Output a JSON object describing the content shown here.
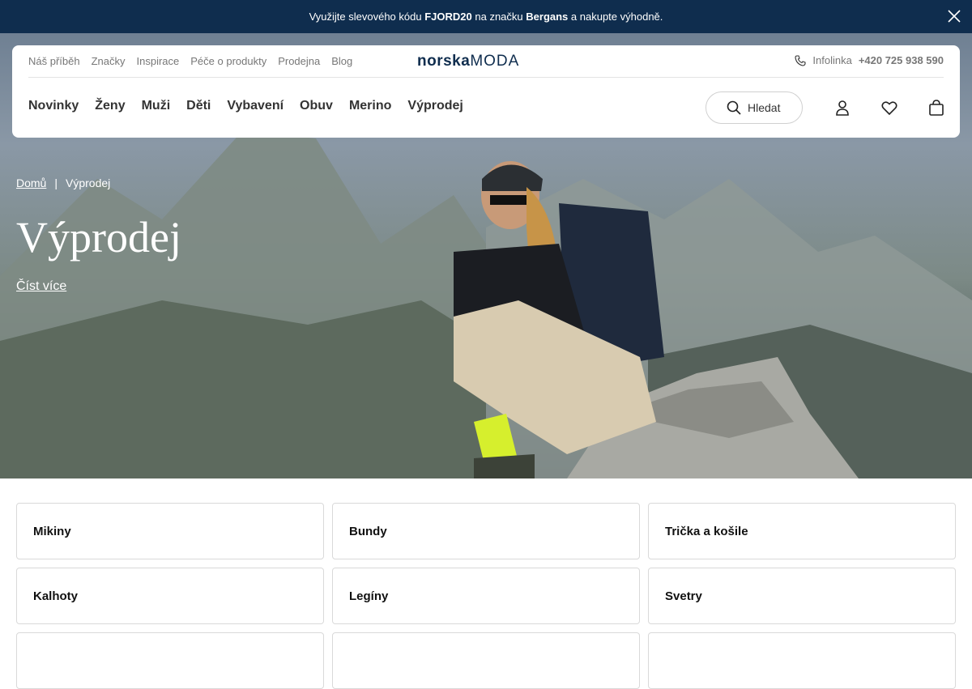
{
  "promo": {
    "text_before": "Využijte slevového kódu",
    "code": "FJORD20",
    "text_mid": "na značku",
    "brand": "Bergans",
    "text_after": "a nakupte výhodně."
  },
  "header": {
    "util_links": [
      "Náš příběh",
      "Značky",
      "Inspirace",
      "Péče o produkty",
      "Prodejna",
      "Blog"
    ],
    "logo_bold": "norska",
    "logo_light": "moda",
    "infoline_label": "Infolinka",
    "infoline_phone": "+420 725 938 590",
    "nav": [
      "Novinky",
      "Ženy",
      "Muži",
      "Děti",
      "Vybavení",
      "Obuv",
      "Merino",
      "Výprodej"
    ],
    "search_label": "Hledat"
  },
  "hero": {
    "breadcrumb_home": "Domů",
    "breadcrumb_sep": "|",
    "breadcrumb_current": "Výprodej",
    "title": "Výprodej",
    "read_more": "Číst více"
  },
  "categories": [
    "Mikiny",
    "Bundy",
    "Trička a košile",
    "Kalhoty",
    "Legíny",
    "Svetry",
    "",
    "",
    ""
  ],
  "colors": {
    "promo_bg": "#0f2d4e",
    "logo": "#0f2d4e",
    "logo_accent": "#d0262d"
  }
}
